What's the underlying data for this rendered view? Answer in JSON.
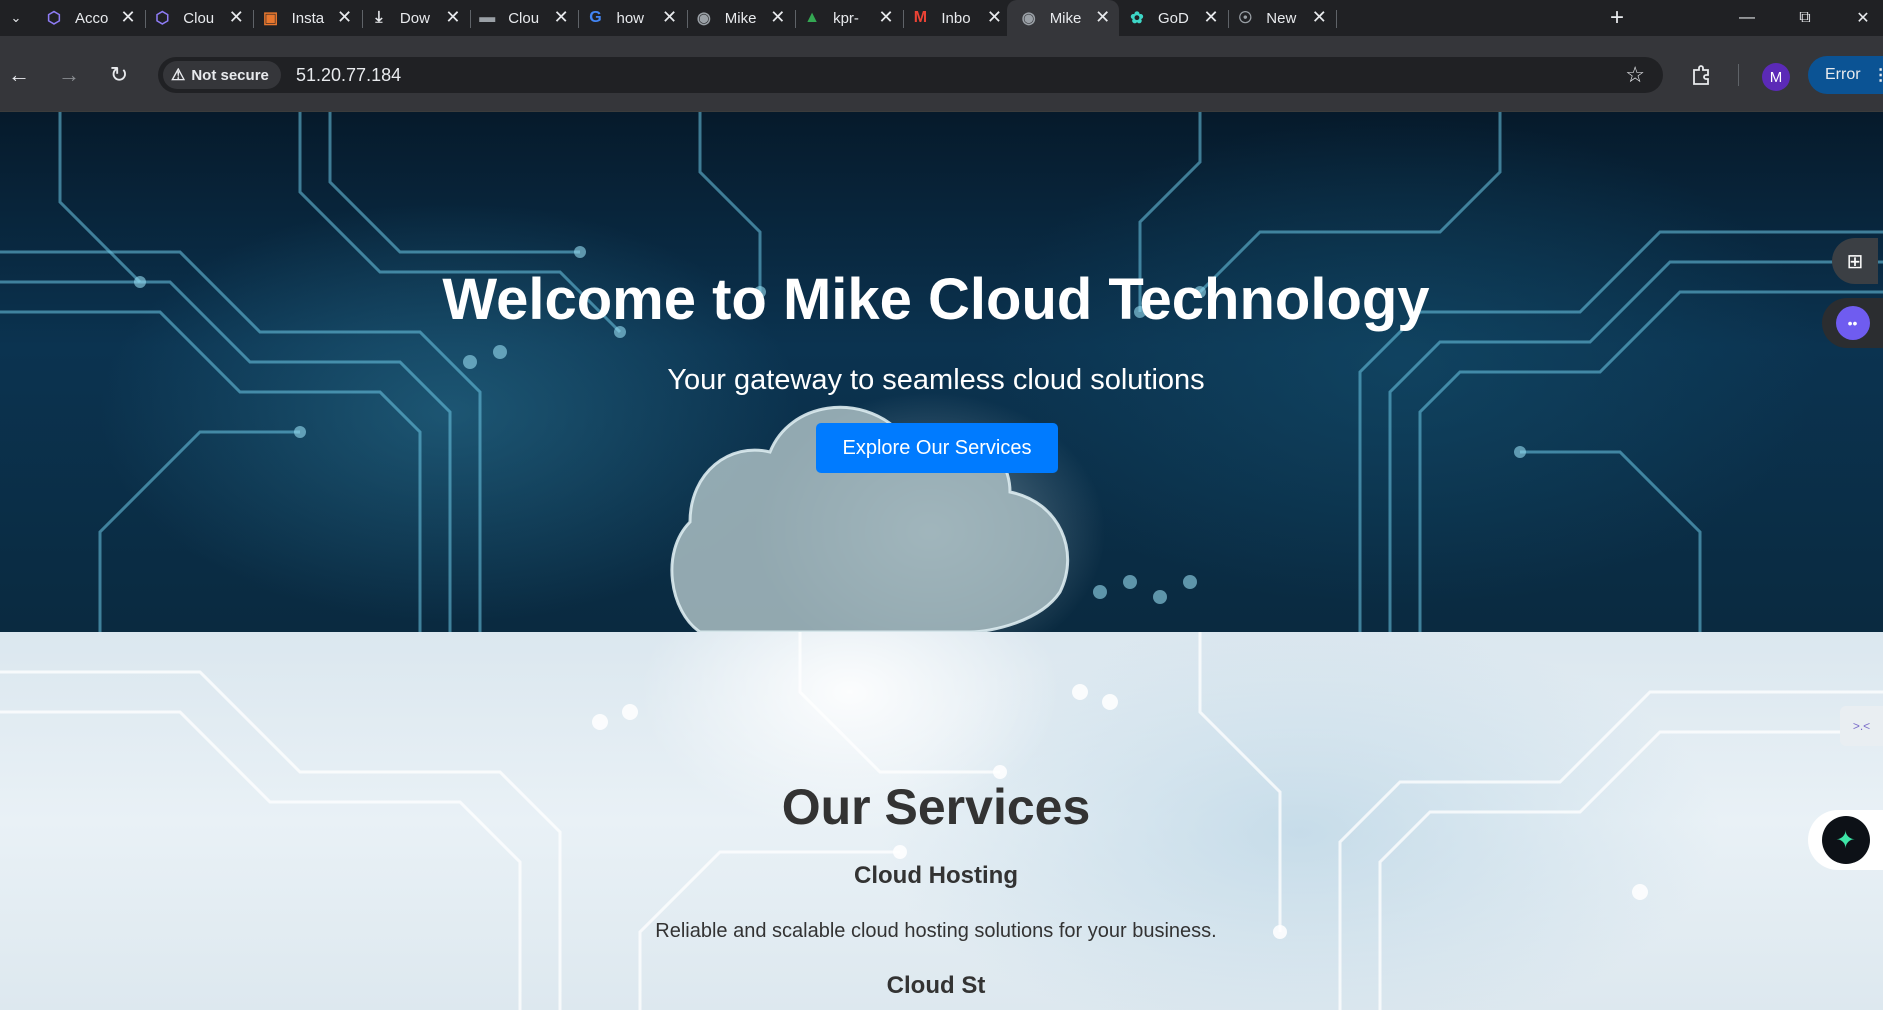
{
  "browser": {
    "tabs": [
      {
        "title": "Acco",
        "icon": "cube-icon",
        "color": "#8e7cf5"
      },
      {
        "title": "Clou",
        "icon": "cube-icon",
        "color": "#8e7cf5"
      },
      {
        "title": "Insta",
        "icon": "instance-icon",
        "color": "#e8772e"
      },
      {
        "title": "Dow",
        "icon": "download-icon",
        "color": "#e8eaed"
      },
      {
        "title": "Clou",
        "icon": "folder-icon",
        "color": "#9aa0a6"
      },
      {
        "title": "how",
        "icon": "google-icon",
        "color": "#4285f4"
      },
      {
        "title": "Mike",
        "icon": "globe-icon",
        "color": "#9aa0a6"
      },
      {
        "title": "kpr-",
        "icon": "drive-icon",
        "color": "#34a853"
      },
      {
        "title": "Inbo",
        "icon": "gmail-icon",
        "color": "#ea4335"
      },
      {
        "title": "Mike",
        "icon": "globe-icon",
        "color": "#9aa0a6",
        "active": true
      },
      {
        "title": "GoD",
        "icon": "godaddy-icon",
        "color": "#3dd6c6"
      },
      {
        "title": "New",
        "icon": "chrome-icon",
        "color": "#9aa0a6"
      }
    ],
    "security_label": "Not secure",
    "url": "51.20.77.184",
    "profile_initial": "M",
    "error_label": "Error"
  },
  "hero": {
    "title": "Welcome to Mike Cloud Technology",
    "subtitle": "Your gateway to seamless cloud solutions",
    "cta_label": "Explore Our Services",
    "cta_color": "#007bff"
  },
  "services": {
    "heading": "Our Services",
    "items": [
      {
        "title": "Cloud Hosting",
        "description": "Reliable and scalable cloud hosting solutions for your business."
      },
      {
        "title": "Cloud St"
      }
    ]
  }
}
